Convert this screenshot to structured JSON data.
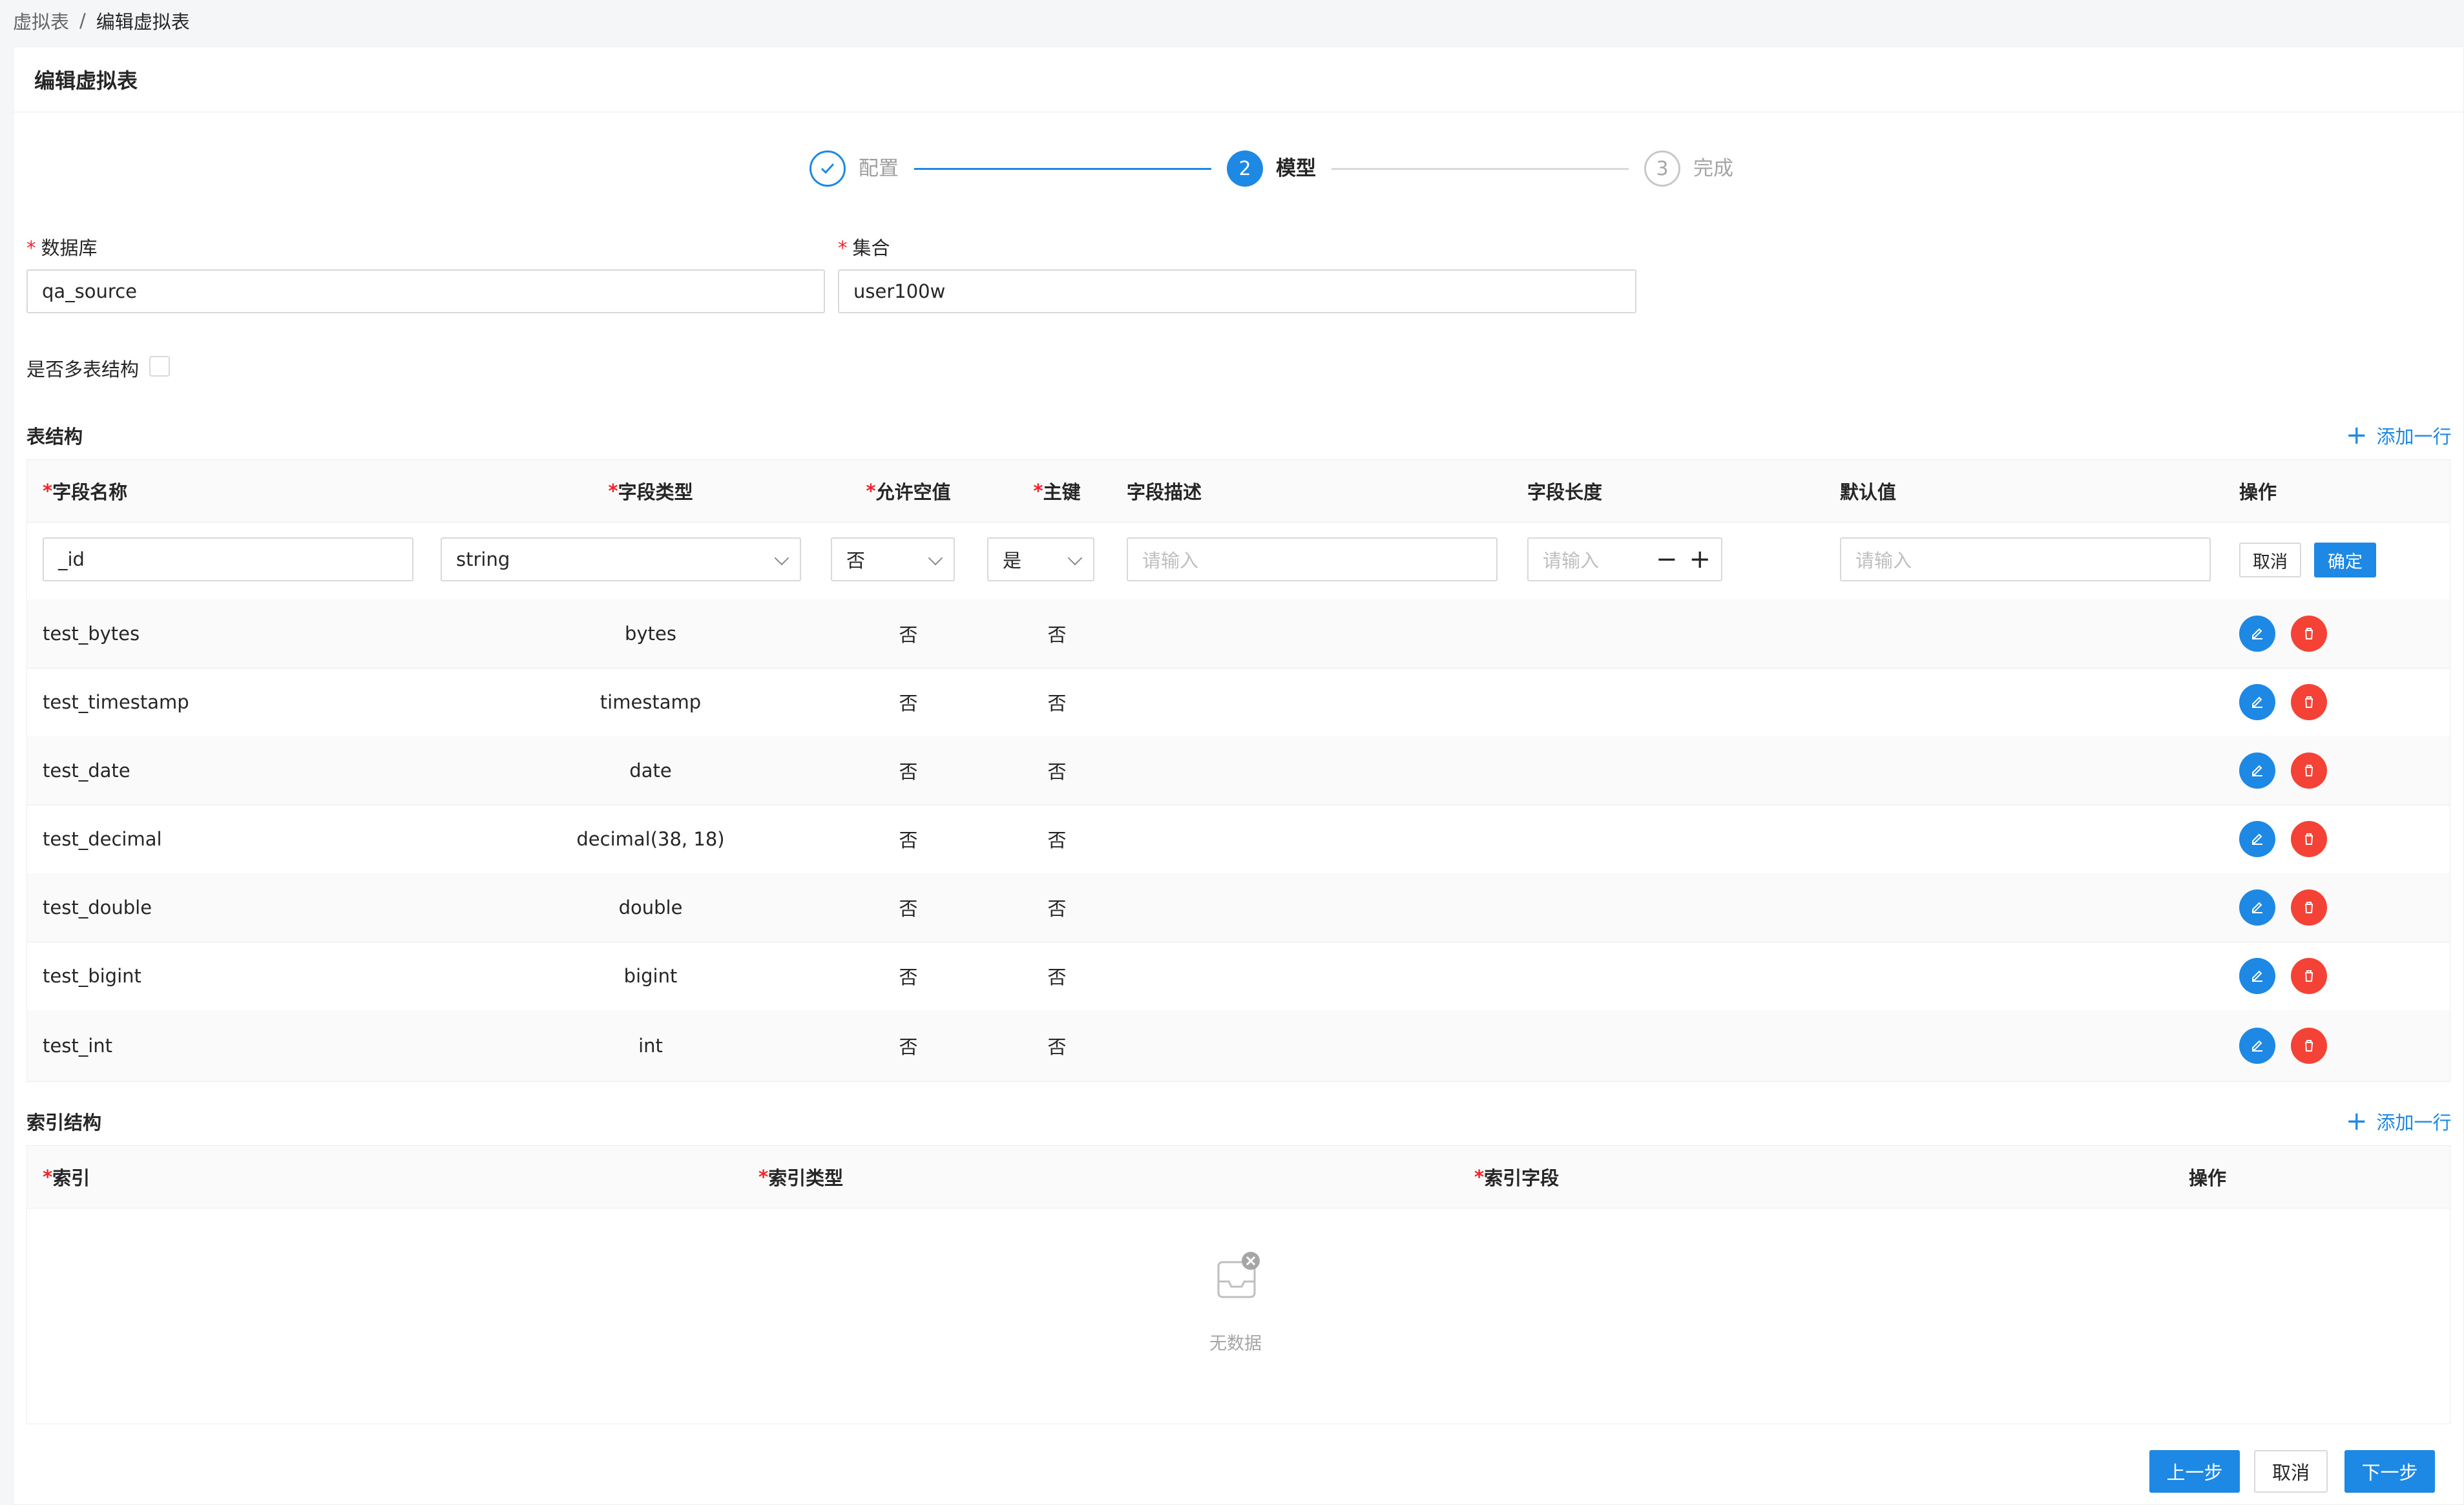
{
  "breadcrumb": {
    "parent": "虚拟表",
    "separator": "/",
    "current": "编辑虚拟表"
  },
  "panel": {
    "title": "编辑虚拟表"
  },
  "steps": [
    {
      "label": "配置",
      "state": "done"
    },
    {
      "label": "模型",
      "state": "active",
      "number": "2"
    },
    {
      "label": "完成",
      "state": "wait",
      "number": "3"
    }
  ],
  "form": {
    "database_label": "数据库",
    "database_value": "qa_source",
    "collection_label": "集合",
    "collection_value": "user100w",
    "multi_table_label": "是否多表结构",
    "required_mark": "*"
  },
  "schema": {
    "title": "表结构",
    "add_row": "添加一行",
    "columns": {
      "field_name": "字段名称",
      "field_type": "字段类型",
      "nullable": "允许空值",
      "primary_key": "主键",
      "description": "字段描述",
      "length": "字段长度",
      "default": "默认值",
      "actions": "操作"
    },
    "editing_row": {
      "field_name": "_id",
      "field_type": "string",
      "nullable": "否",
      "primary_key": "是",
      "description_placeholder": "请输入",
      "length_placeholder": "请输入",
      "stepper_minus": "−",
      "stepper_plus": "+",
      "default_placeholder": "请输入",
      "cancel": "取消",
      "confirm": "确定"
    },
    "rows": [
      {
        "name": "test_bytes",
        "type": "bytes",
        "nullable": "否",
        "pk": "否"
      },
      {
        "name": "test_timestamp",
        "type": "timestamp",
        "nullable": "否",
        "pk": "否"
      },
      {
        "name": "test_date",
        "type": "date",
        "nullable": "否",
        "pk": "否"
      },
      {
        "name": "test_decimal",
        "type": "decimal(38, 18)",
        "nullable": "否",
        "pk": "否"
      },
      {
        "name": "test_double",
        "type": "double",
        "nullable": "否",
        "pk": "否"
      },
      {
        "name": "test_bigint",
        "type": "bigint",
        "nullable": "否",
        "pk": "否"
      },
      {
        "name": "test_int",
        "type": "int",
        "nullable": "否",
        "pk": "否"
      }
    ]
  },
  "index": {
    "title": "索引结构",
    "add_row": "添加一行",
    "columns": {
      "index": "索引",
      "index_type": "索引类型",
      "index_field": "索引字段",
      "actions": "操作"
    },
    "empty_text": "无数据"
  },
  "footer": {
    "prev": "上一步",
    "cancel": "取消",
    "next": "下一步"
  },
  "colors": {
    "primary": "#1e88e5",
    "danger": "#f44336",
    "required": "#f5222d"
  }
}
